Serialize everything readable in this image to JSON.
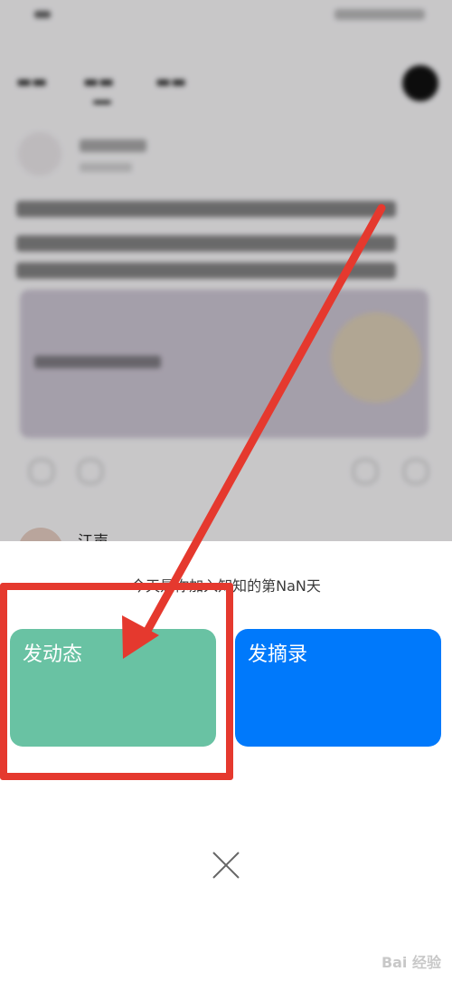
{
  "background_feed": {
    "partial_user_name": "江声"
  },
  "sheet": {
    "prompt_text": "今天是你加入知知的第NaN天",
    "buttons": [
      {
        "label": "发动态",
        "color": "#69c2a3"
      },
      {
        "label": "发摘录",
        "color": "#0079fb"
      }
    ]
  },
  "annotations": {
    "highlight_color": "#e5392e"
  },
  "watermark": {
    "text": "Bai 经验"
  }
}
